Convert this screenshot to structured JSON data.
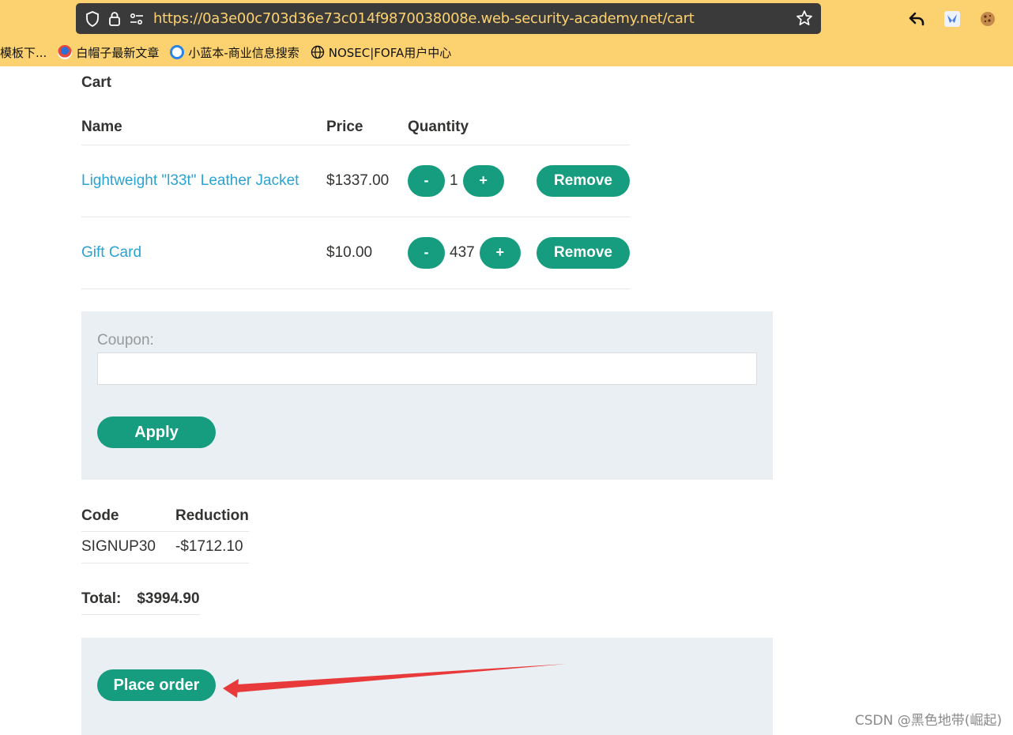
{
  "browser": {
    "url": "https://0a3e00c703d36e73c014f9870038008e.web-security-academy.net/cart",
    "bookmarks": [
      {
        "label": "模板下..."
      },
      {
        "label": "白帽子最新文章"
      },
      {
        "label": "小蓝本-商业信息搜索"
      },
      {
        "label": "NOSEC|FOFA用户中心"
      }
    ]
  },
  "cart": {
    "title": "Cart",
    "headers": {
      "name": "Name",
      "price": "Price",
      "quantity": "Quantity"
    },
    "items": [
      {
        "name": "Lightweight \"l33t\" Leather Jacket",
        "price": "$1337.00",
        "quantity": "1"
      },
      {
        "name": "Gift Card",
        "price": "$10.00",
        "quantity": "437"
      }
    ],
    "minus_label": "-",
    "plus_label": "+",
    "remove_label": "Remove"
  },
  "coupon": {
    "label": "Coupon:",
    "value": "",
    "apply_label": "Apply"
  },
  "codes": {
    "headers": {
      "code": "Code",
      "reduction": "Reduction"
    },
    "rows": [
      {
        "code": "SIGNUP30",
        "reduction": "-$1712.10"
      }
    ]
  },
  "total": {
    "label": "Total:",
    "value": "$3994.90"
  },
  "order": {
    "place_label": "Place order"
  },
  "watermark": "CSDN @黑色地带(崛起)",
  "colors": {
    "accent": "#169c7f",
    "link": "#29a3d3",
    "chrome": "#fcd270",
    "annotation": "#e83a3a"
  }
}
